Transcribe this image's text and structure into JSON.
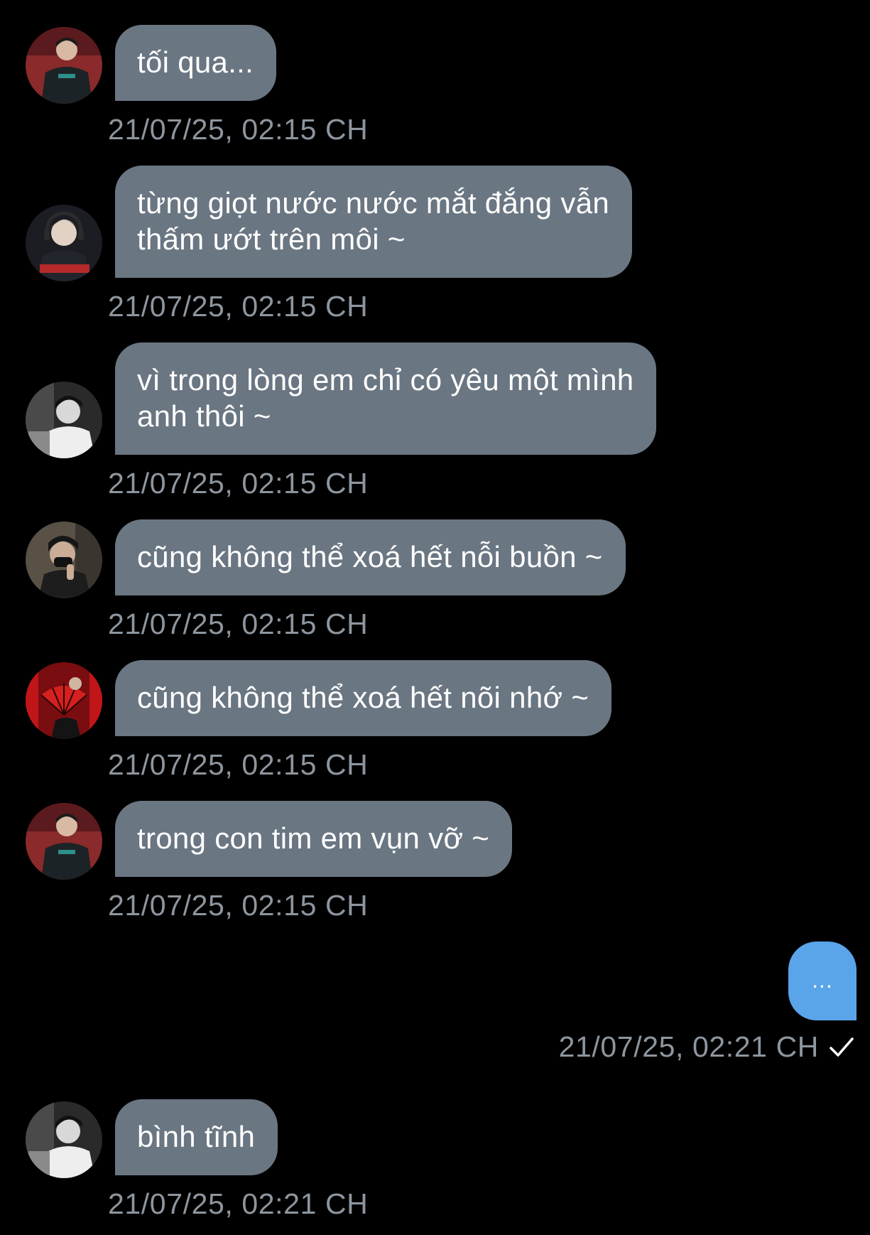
{
  "conversation": {
    "incoming": [
      {
        "text": "tối qua...",
        "time": "21/07/25, 02:15 CH",
        "avatar": "avatar-photo-red-jacket"
      },
      {
        "text": "từng giọt nước nước mắt đắng vẫn\nthấm ướt trên môi ~",
        "time": "21/07/25, 02:15 CH",
        "avatar": "avatar-photo-blond-headset"
      },
      {
        "text": "vì trong lòng em chỉ có yêu một mình\nanh thôi ~",
        "time": "21/07/25, 02:15 CH",
        "avatar": "avatar-photo-monochrome"
      },
      {
        "text": "cũng không thể xoá hết nỗi buồn ~",
        "time": "21/07/25, 02:15 CH",
        "avatar": "avatar-photo-masked"
      },
      {
        "text": "cũng không thể xoá hết nõi nhớ ~",
        "time": "21/07/25, 02:15 CH",
        "avatar": "avatar-photo-red-fan"
      },
      {
        "text": "trong con tim em vụn vỡ ~",
        "time": "21/07/25, 02:15 CH",
        "avatar": "avatar-photo-red-jacket"
      },
      {
        "text": "bình tĩnh",
        "time": "21/07/25, 02:21 CH",
        "avatar": "avatar-photo-monochrome"
      }
    ],
    "outgoing": {
      "text": "...",
      "time": "21/07/25, 02:21 CH",
      "status_icon": "checkmark-icon"
    }
  },
  "colors": {
    "background": "#000000",
    "incoming_bubble": "#6a7682",
    "outgoing_bubble": "#5aa5ea",
    "timestamp": "#8d969f"
  }
}
